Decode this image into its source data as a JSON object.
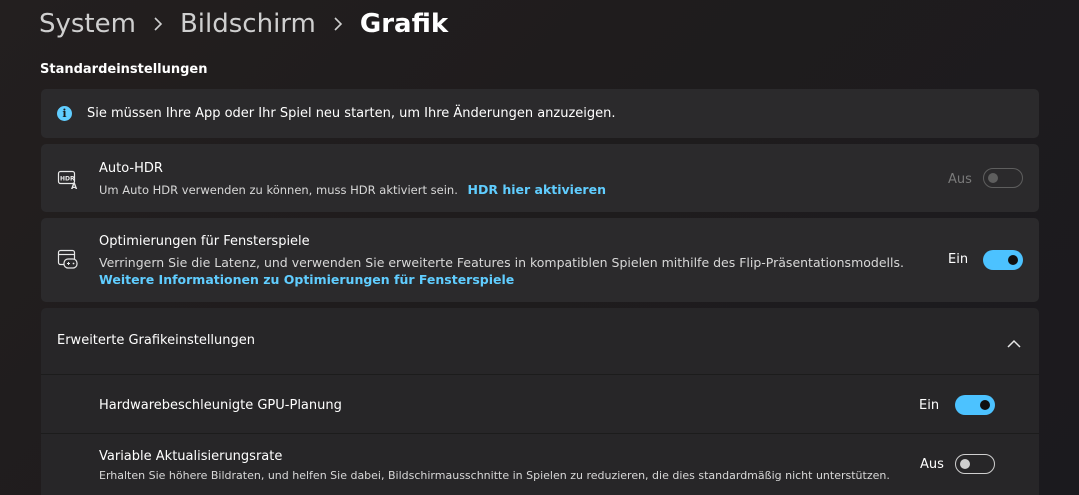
{
  "breadcrumb": {
    "items": [
      "System",
      "Bildschirm",
      "Grafik"
    ]
  },
  "section_title": "Standardeinstellungen",
  "info": {
    "icon": "info-icon",
    "text": "Sie müssen Ihre App oder Ihr Spiel neu starten, um Ihre Änderungen anzuzeigen."
  },
  "auto_hdr": {
    "icon": "hdr-icon",
    "title": "Auto-HDR",
    "description": "Um Auto HDR verwenden zu können, muss HDR aktiviert sein.",
    "link": "HDR hier aktivieren",
    "state": "Aus",
    "enabled": false,
    "disabled": true
  },
  "window_opt": {
    "icon": "windowed-game-icon",
    "title": "Optimierungen für Fensterspiele",
    "description": "Verringern Sie die Latenz, und verwenden Sie erweiterte Features in kompatiblen Spielen mithilfe des Flip-Präsentationsmodells.",
    "link": "Weitere Informationen zu Optimierungen für Fensterspiele",
    "state": "Ein",
    "enabled": true
  },
  "advanced": {
    "title": "Erweiterte Grafikeinstellungen",
    "expanded": true,
    "gpu": {
      "title": "Hardwarebeschleunigte GPU-Planung",
      "state": "Ein",
      "enabled": true
    },
    "vrr": {
      "title": "Variable Aktualisierungsrate",
      "description": "Erhalten Sie höhere Bildraten, und helfen Sie dabei, Bildschirmausschnitte in Spielen zu reduzieren, die dies standardmäßig nicht unterstützen.",
      "state": "Aus",
      "enabled": false
    }
  },
  "colors": {
    "accent": "#4cc2ff",
    "link": "#60cdff",
    "card": "#2b2a2c"
  }
}
